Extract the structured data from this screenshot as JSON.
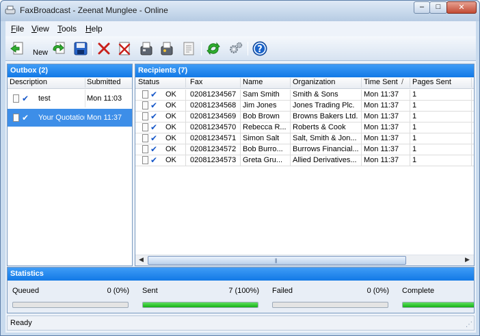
{
  "window": {
    "title": "FaxBroadcast - Zeenat Munglee - Online",
    "controls": {
      "minimize": "–",
      "maximize": "□",
      "close": "✕"
    }
  },
  "menu": [
    {
      "label": "File",
      "accel": "F",
      "rest": "ile"
    },
    {
      "label": "View",
      "accel": "V",
      "rest": "iew"
    },
    {
      "label": "Tools",
      "accel": "T",
      "rest": "ools"
    },
    {
      "label": "Help",
      "accel": "H",
      "rest": "elp"
    }
  ],
  "toolbar": {
    "new_label": "New",
    "icons": [
      "new-icon",
      "reload-icon",
      "save-icon",
      "delete-icon",
      "cancel-icon",
      "fax-machine-icon",
      "fax-send-icon",
      "report-icon",
      "refresh-icon",
      "settings-icon",
      "help-icon"
    ]
  },
  "outbox": {
    "header": "Outbox (2)",
    "columns": [
      "Description",
      "Submitted"
    ],
    "rows": [
      {
        "description": "test",
        "submitted": "Mon 11:03",
        "selected": false
      },
      {
        "description": "Your Quotation",
        "submitted": "Mon 11:37",
        "selected": true
      }
    ]
  },
  "recipients": {
    "header": "Recipients (7)",
    "columns": [
      "Status",
      "Fax",
      "Name",
      "Organization",
      "Time Sent",
      "Pages Sent"
    ],
    "sort_indicator": "/",
    "rows": [
      {
        "status": "OK",
        "fax": "02081234567",
        "name": "Sam  Smith",
        "organization": "Smith & Sons",
        "time": "Mon 11:37",
        "pages": "1"
      },
      {
        "status": "OK",
        "fax": "02081234568",
        "name": "Jim Jones",
        "organization": "Jones Trading Plc.",
        "time": "Mon 11:37",
        "pages": "1"
      },
      {
        "status": "OK",
        "fax": "02081234569",
        "name": "Bob  Brown",
        "organization": "Browns Bakers Ltd.",
        "time": "Mon 11:37",
        "pages": "1"
      },
      {
        "status": "OK",
        "fax": "02081234570",
        "name": "Rebecca R...",
        "organization": "Roberts & Cook",
        "time": "Mon 11:37",
        "pages": "1"
      },
      {
        "status": "OK",
        "fax": "02081234571",
        "name": "Simon Salt",
        "organization": "Salt, Smith & Jon...",
        "time": "Mon 11:37",
        "pages": "1"
      },
      {
        "status": "OK",
        "fax": "02081234572",
        "name": "Bob  Burro...",
        "organization": "Burrows Financial...",
        "time": "Mon 11:37",
        "pages": "1"
      },
      {
        "status": "OK",
        "fax": "02081234573",
        "name": "Greta  Gru...",
        "organization": "Allied Derivatives...",
        "time": "Mon 11:37",
        "pages": "1"
      }
    ]
  },
  "statistics": {
    "header": "Statistics",
    "items": [
      {
        "label": "Queued",
        "value": "0 (0%)",
        "progress": 0
      },
      {
        "label": "Sent",
        "value": "7 (100%)",
        "progress": 1
      },
      {
        "label": "Failed",
        "value": "0 (0%)",
        "progress": 0
      },
      {
        "label": "Complete",
        "value": "",
        "progress": 1
      }
    ]
  },
  "status_bar": {
    "text": "Ready"
  },
  "colors": {
    "header_blue": "#1b83ee",
    "selection": "#3d8ee8",
    "progress_green": "#22c022"
  }
}
